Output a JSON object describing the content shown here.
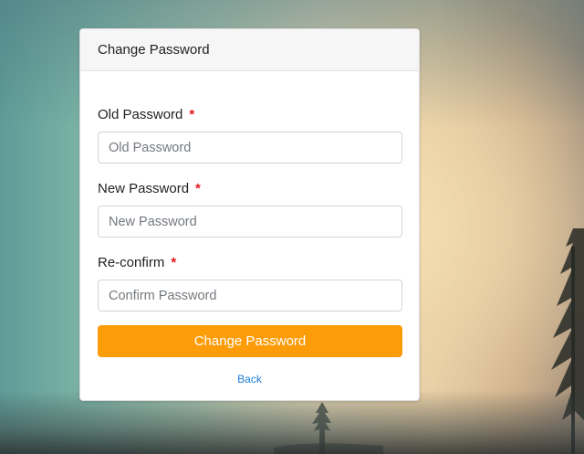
{
  "card": {
    "title": "Change Password"
  },
  "fields": [
    {
      "label": "Old Password",
      "required_mark": "*",
      "placeholder": "Old Password",
      "value": ""
    },
    {
      "label": "New Password",
      "required_mark": "*",
      "placeholder": "New Password",
      "value": ""
    },
    {
      "label": "Re-confirm",
      "required_mark": "*",
      "placeholder": "Confirm Password",
      "value": ""
    }
  ],
  "actions": {
    "submit_label": "Change Password",
    "back_label": "Back"
  },
  "colors": {
    "accent": "#fc9c08",
    "required": "#e0191d",
    "link": "#1c7cd5"
  }
}
